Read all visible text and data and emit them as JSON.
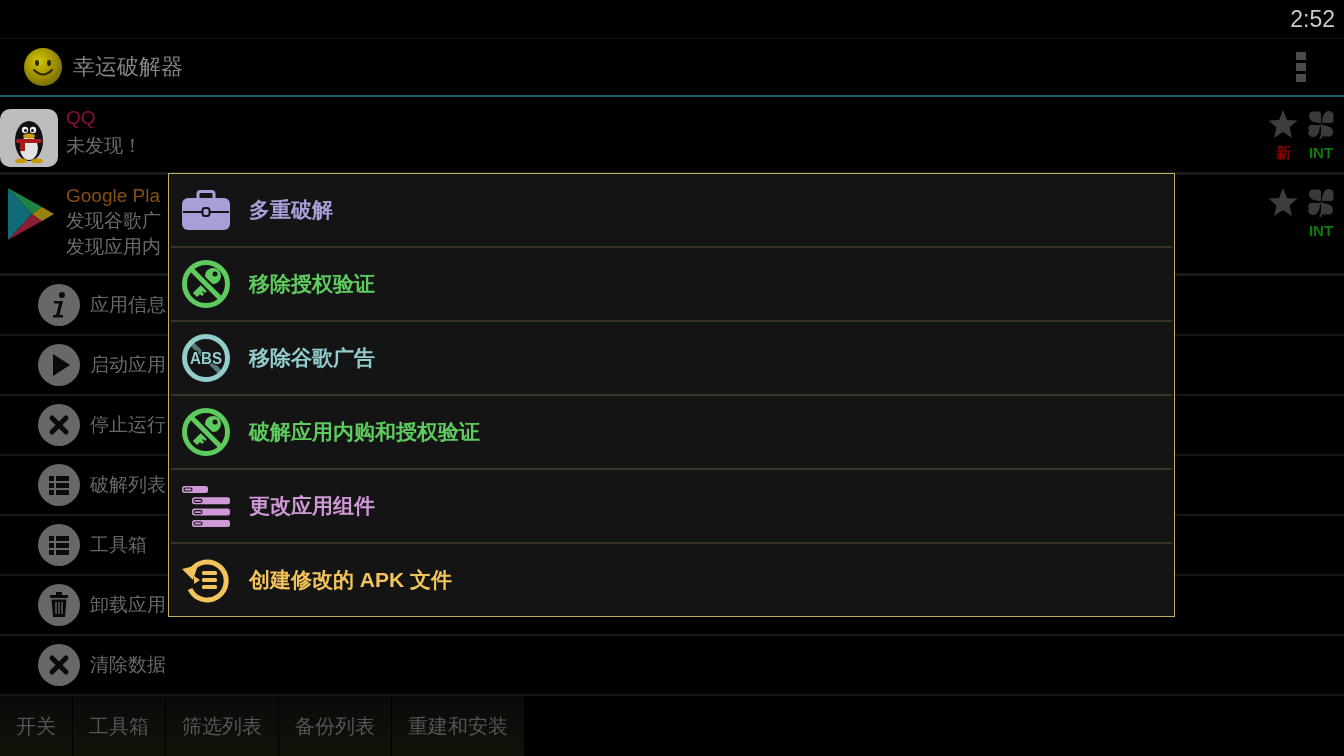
{
  "status_bar": {
    "time": "2:52"
  },
  "action_bar": {
    "title": "幸运破解器"
  },
  "apps": [
    {
      "name": "QQ",
      "color": "#8a0c3a",
      "details": [
        "未发现！"
      ],
      "star_caption": "新",
      "clover_caption": "INT"
    },
    {
      "name": "Google Pla",
      "color": "#86500f",
      "details": [
        "发现谷歌广",
        "发现应用内"
      ],
      "clover_caption": "INT"
    }
  ],
  "actions": [
    "应用信息",
    "启动应用",
    "停止运行",
    "破解列表",
    "工具箱",
    "卸载应用",
    "清除数据"
  ],
  "dialog": {
    "items": [
      {
        "label": "多重破解",
        "color": "#a7a0d8"
      },
      {
        "label": "移除授权验证",
        "color": "#5fcb5f"
      },
      {
        "label": "移除谷歌广告",
        "color": "#93cccc",
        "icon_text": "ABS"
      },
      {
        "label": "破解应用内购和授权验证",
        "color": "#5fcb5f"
      },
      {
        "label": "更改应用组件",
        "color": "#cf98d6"
      },
      {
        "label": "创建修改的 APK 文件",
        "color": "#f3c45c"
      }
    ]
  },
  "bottom_tabs": [
    "开关",
    "工具箱",
    "筛选列表",
    "备份列表",
    "重建和安装"
  ]
}
